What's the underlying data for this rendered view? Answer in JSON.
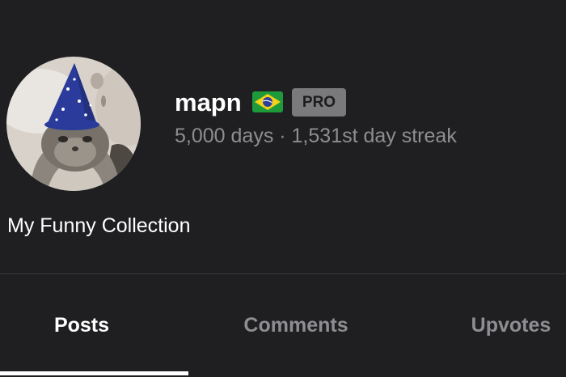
{
  "profile": {
    "username": "mapn",
    "flag_icon": "brazil-flag-icon",
    "badge": "PRO",
    "stats": "5,000 days · 1,531st day streak",
    "bio": "My Funny Collection"
  },
  "avatar": {
    "icon": "cat-in-wizard-hat-avatar"
  },
  "tabs": [
    {
      "label": "Posts",
      "active": true
    },
    {
      "label": "Comments",
      "active": false
    },
    {
      "label": "Upvotes",
      "active": false
    }
  ],
  "colors": {
    "background": "#1f1f21",
    "text_primary": "#ffffff",
    "text_secondary": "#8e8e92",
    "badge_background": "#7a7a7c",
    "divider": "#39393c"
  }
}
